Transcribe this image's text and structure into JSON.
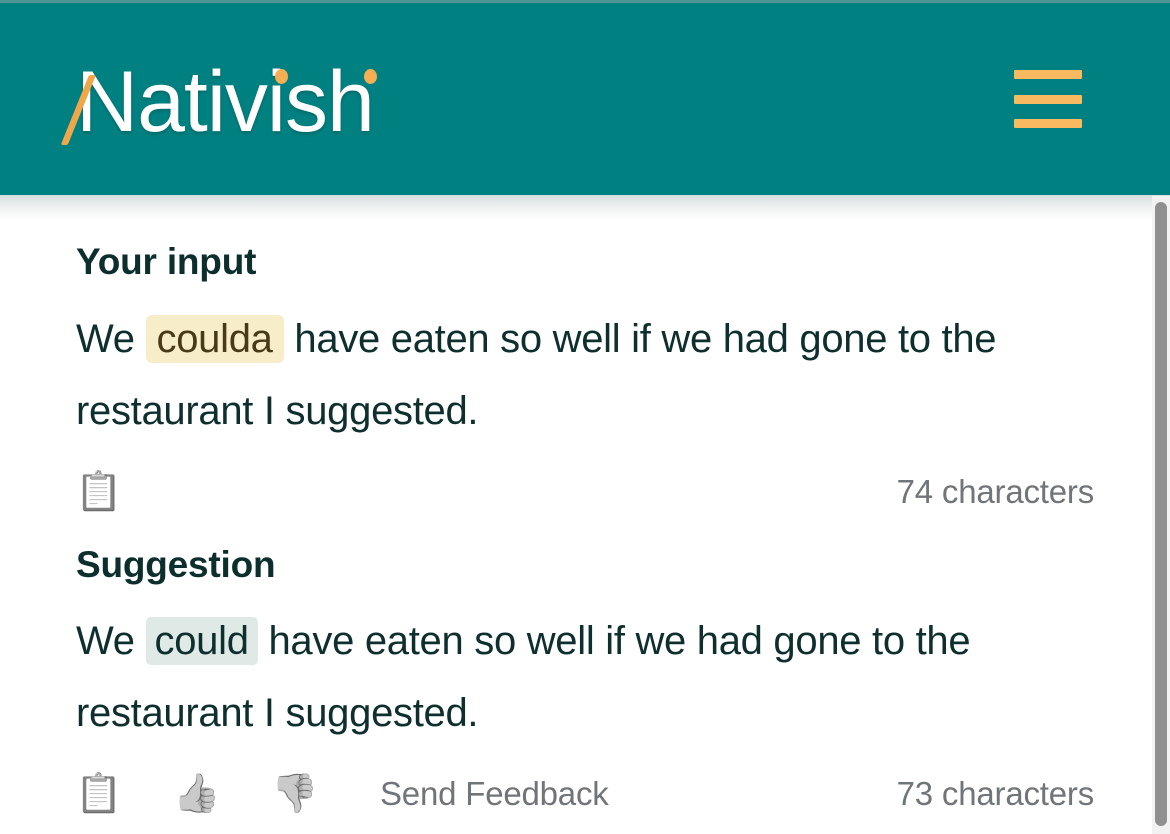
{
  "header": {
    "brand": "Nativish",
    "menu_icon": "hamburger-icon",
    "background_color": "#008080",
    "accent_color": "#f9b961"
  },
  "input_section": {
    "title": "Your input",
    "text_before": "We",
    "highlight": "coulda",
    "text_after": "have eaten so well if we had gone to the restaurant I suggested.",
    "full_text": "We coulda have eaten so well if we had gone to the restaurant I suggested.",
    "highlight_color": "#f8edc9",
    "copy_icon": "clipboard-icon",
    "char_count": "74 characters"
  },
  "suggestion_section": {
    "title": "Suggestion",
    "text_before": "We",
    "highlight": "could",
    "text_after": "have eaten so well if we had gone to the restaurant I suggested.",
    "full_text": "We could have eaten so well if we had gone to the restaurant I suggested.",
    "highlight_color": "#dfeae7",
    "copy_icon": "clipboard-icon",
    "thumbs_up_icon": "thumbs-up-icon",
    "thumbs_down_icon": "thumbs-down-icon",
    "send_feedback_label": "Send Feedback",
    "char_count": "73 characters"
  },
  "icons": {
    "clipboard": "📋",
    "thumbs_up": "👍",
    "thumbs_down": "👎"
  }
}
